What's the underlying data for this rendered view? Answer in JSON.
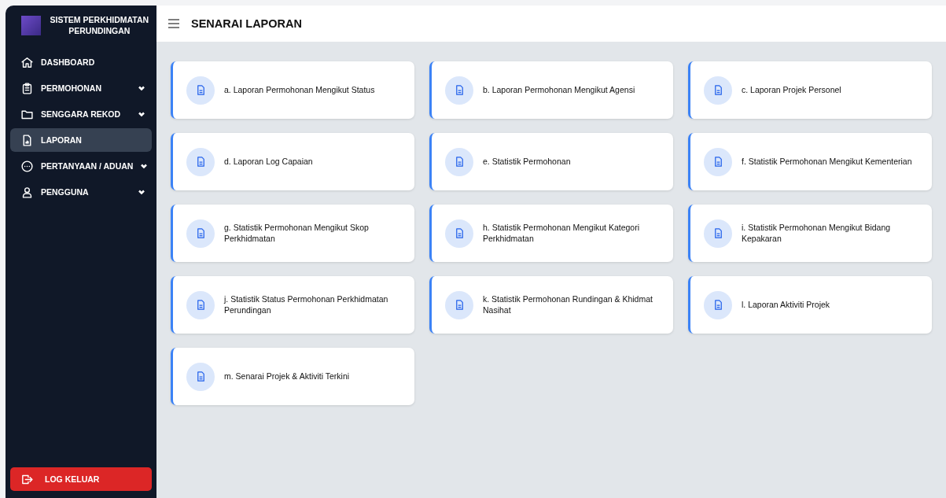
{
  "sidebar": {
    "brand": "SISTEM PERKHIDMATAN PERUNDINGAN",
    "items": [
      {
        "label": "DASHBOARD",
        "expandable": false,
        "selected": false
      },
      {
        "label": "PERMOHONAN",
        "expandable": true,
        "selected": false
      },
      {
        "label": "SENGGARA REKOD",
        "expandable": true,
        "selected": false
      },
      {
        "label": "LAPORAN",
        "expandable": false,
        "selected": true
      },
      {
        "label": "PERTANYAAN / ADUAN",
        "expandable": true,
        "selected": false
      },
      {
        "label": "PENGGUNA",
        "expandable": true,
        "selected": false
      }
    ],
    "logout": "LOG KELUAR"
  },
  "header": {
    "title": "SENARAI LAPORAN"
  },
  "reports": [
    "a. Laporan Permohonan Mengikut Status",
    "b. Laporan Permohonan Mengikut Agensi",
    "c. Laporan Projek Personel",
    "d. Laporan Log Capaian",
    "e. Statistik Permohonan",
    "f. Statistik Permohonan Mengikut Kementerian",
    "g. Statistik Permohonan Mengikut Skop Perkhidmatan",
    "h. Statistik Permohonan Mengikut Kategori Perkhidmatan",
    "i. Statistik Permohonan Mengikut Bidang Kepakaran",
    "j. Statistik Status Permohonan Perkhidmatan Perundingan",
    "k. Statistik Permohonan Rundingan & Khidmat Nasihat",
    "l. Laporan Aktiviti Projek",
    "m. Senarai Projek & Aktiviti Terkini"
  ]
}
